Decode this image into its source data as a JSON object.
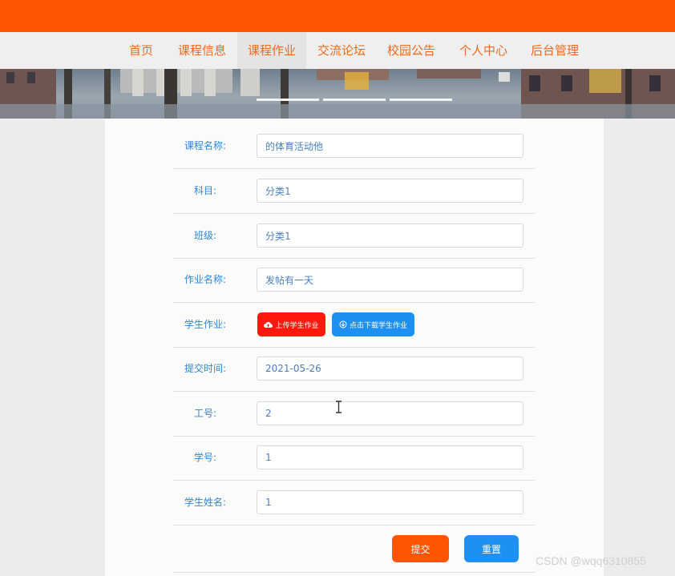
{
  "nav": {
    "items": [
      "首页",
      "课程信息",
      "课程作业",
      "交流论坛",
      "校园公告",
      "个人中心",
      "后台管理"
    ]
  },
  "form": {
    "course_name": {
      "label": "课程名称:",
      "value": "的体育活动他"
    },
    "subject": {
      "label": "科目:",
      "value": "分类1"
    },
    "class": {
      "label": "班级:",
      "value": "分类1"
    },
    "homework_name": {
      "label": "作业名称:",
      "value": "发帖有一天"
    },
    "student_homework": {
      "label": "学生作业:",
      "upload_label": "上传学生作业",
      "download_label": "点击下载学生作业"
    },
    "submit_time": {
      "label": "提交时间:",
      "value": "2021-05-26"
    },
    "staff_no": {
      "label": "工号:",
      "value": "2"
    },
    "student_no": {
      "label": "学号:",
      "value": "1"
    },
    "student_name": {
      "label": "学生姓名:",
      "value": "1"
    },
    "submit_label": "提交",
    "reset_label": "重置"
  },
  "watermark": "CSDN @wqq6310855",
  "colors": {
    "topbar": "#ff5500",
    "nav_text": "#ee6a1c",
    "label_blue": "#2f86d7",
    "upload_red": "#ff1a0d",
    "download_blue": "#1e90f2",
    "submit_orange": "#ff5500",
    "reset_blue": "#1e90f2"
  },
  "icons": {
    "upload": "cloud-upload-icon",
    "download": "download-circle-icon",
    "cursor": "text-cursor-icon"
  }
}
